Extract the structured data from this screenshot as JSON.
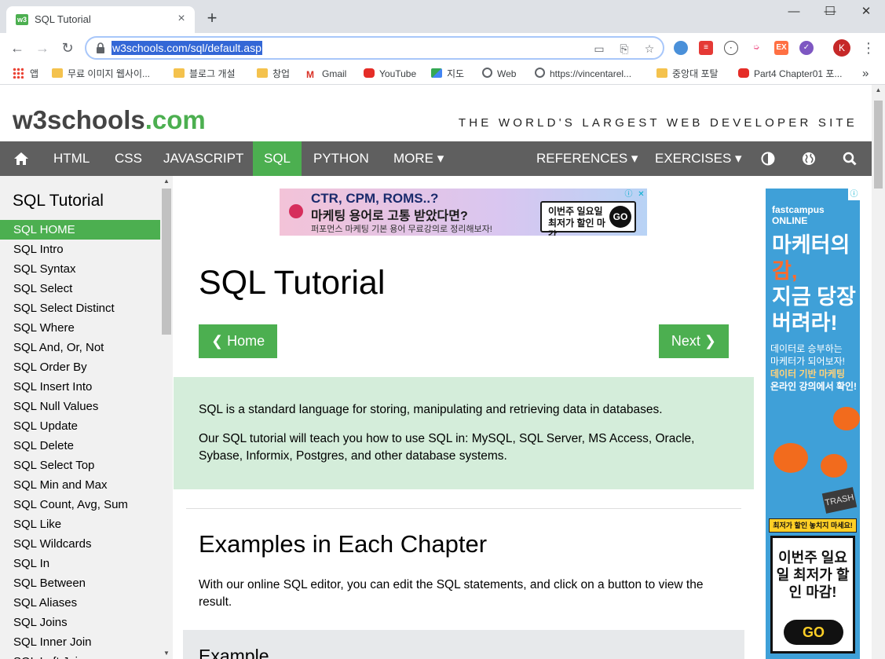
{
  "browser": {
    "tab_title": "SQL Tutorial",
    "tab_favicon": "w3",
    "new_tab": "+",
    "url": "w3schools.com/sql/default.asp",
    "profile_initial": "K",
    "window_controls": {
      "minimize": "—",
      "maximize": "☐",
      "close": "✕"
    },
    "bookmarks": [
      {
        "label": "앱",
        "icon": "apps-icon"
      },
      {
        "label": "무료 이미지 웹사이...",
        "icon": "folder-icon"
      },
      {
        "label": "블로그 개설",
        "icon": "folder-icon"
      },
      {
        "label": "창업",
        "icon": "folder-icon"
      },
      {
        "label": "Gmail",
        "icon": "gmail-icon"
      },
      {
        "label": "YouTube",
        "icon": "youtube-icon"
      },
      {
        "label": "지도",
        "icon": "maps-icon"
      },
      {
        "label": "Web",
        "icon": "globe-icon"
      },
      {
        "label": "https://vincentarel...",
        "icon": "globe-icon"
      },
      {
        "label": "중앙대 포탈",
        "icon": "folder-icon"
      },
      {
        "label": "Part4 Chapter01 포...",
        "icon": "youtube-icon"
      }
    ],
    "bookmarks_more": "»"
  },
  "site": {
    "logo_main": "w3schools",
    "logo_tld": ".com",
    "tagline": "THE WORLD'S LARGEST WEB DEVELOPER SITE",
    "nav": {
      "html": "HTML",
      "css": "CSS",
      "javascript": "JAVASCRIPT",
      "sql": "SQL",
      "python": "PYTHON",
      "more": "MORE ▾",
      "references": "REFERENCES ▾",
      "exercises": "EXERCISES ▾"
    },
    "accent": "#4caf50"
  },
  "sidebar": {
    "title": "SQL Tutorial",
    "links": [
      "SQL HOME",
      "SQL Intro",
      "SQL Syntax",
      "SQL Select",
      "SQL Select Distinct",
      "SQL Where",
      "SQL And, Or, Not",
      "SQL Order By",
      "SQL Insert Into",
      "SQL Null Values",
      "SQL Update",
      "SQL Delete",
      "SQL Select Top",
      "SQL Min and Max",
      "SQL Count, Avg, Sum",
      "SQL Like",
      "SQL Wildcards",
      "SQL In",
      "SQL Between",
      "SQL Aliases",
      "SQL Joins",
      "SQL Inner Join",
      "SQL Left Join"
    ],
    "active_index": 0
  },
  "main": {
    "ad_top": {
      "line1": "CTR, CPM, ROMS..?",
      "line2": "마케팅 용어로 고통 받았다면?",
      "line3": "퍼포먼스 마케팅 기본 용어 무료강의로 정리해보자!",
      "badge": "이번주 일요일 최저가 할인 마감",
      "go": "GO"
    },
    "title": "SQL Tutorial",
    "prev_button": "❮ Home",
    "next_button": "Next ❯",
    "intro_p1": "SQL is a standard language for storing, manipulating and retrieving data in databases.",
    "intro_p2": "Our SQL tutorial will teach you how to use SQL in: MySQL, SQL Server, MS Access, Oracle, Sybase, Informix, Postgres, and other database systems.",
    "section_title": "Examples in Each Chapter",
    "section_text": "With our online SQL editor, you can edit the SQL statements, and click on a button to view the result.",
    "example_label": "Example"
  },
  "ad_side": {
    "brand": "fastcampus ONLINE",
    "headline_1": "마케터의",
    "headline_2": "감,",
    "headline_3": "지금 당장",
    "headline_4": "버려라!",
    "sub_1": "데이터로 승부하는",
    "sub_2": "마케터가 되어보자!",
    "sub_3": "데이터 기반 마케팅",
    "sub_4": "온라인 강의에서 확인!",
    "trash": "TRASH",
    "tag": "최저가 할인 놓치지 마세요!",
    "box_text": "이번주 일요일 최저가 할인 마감!",
    "go": "GO"
  }
}
